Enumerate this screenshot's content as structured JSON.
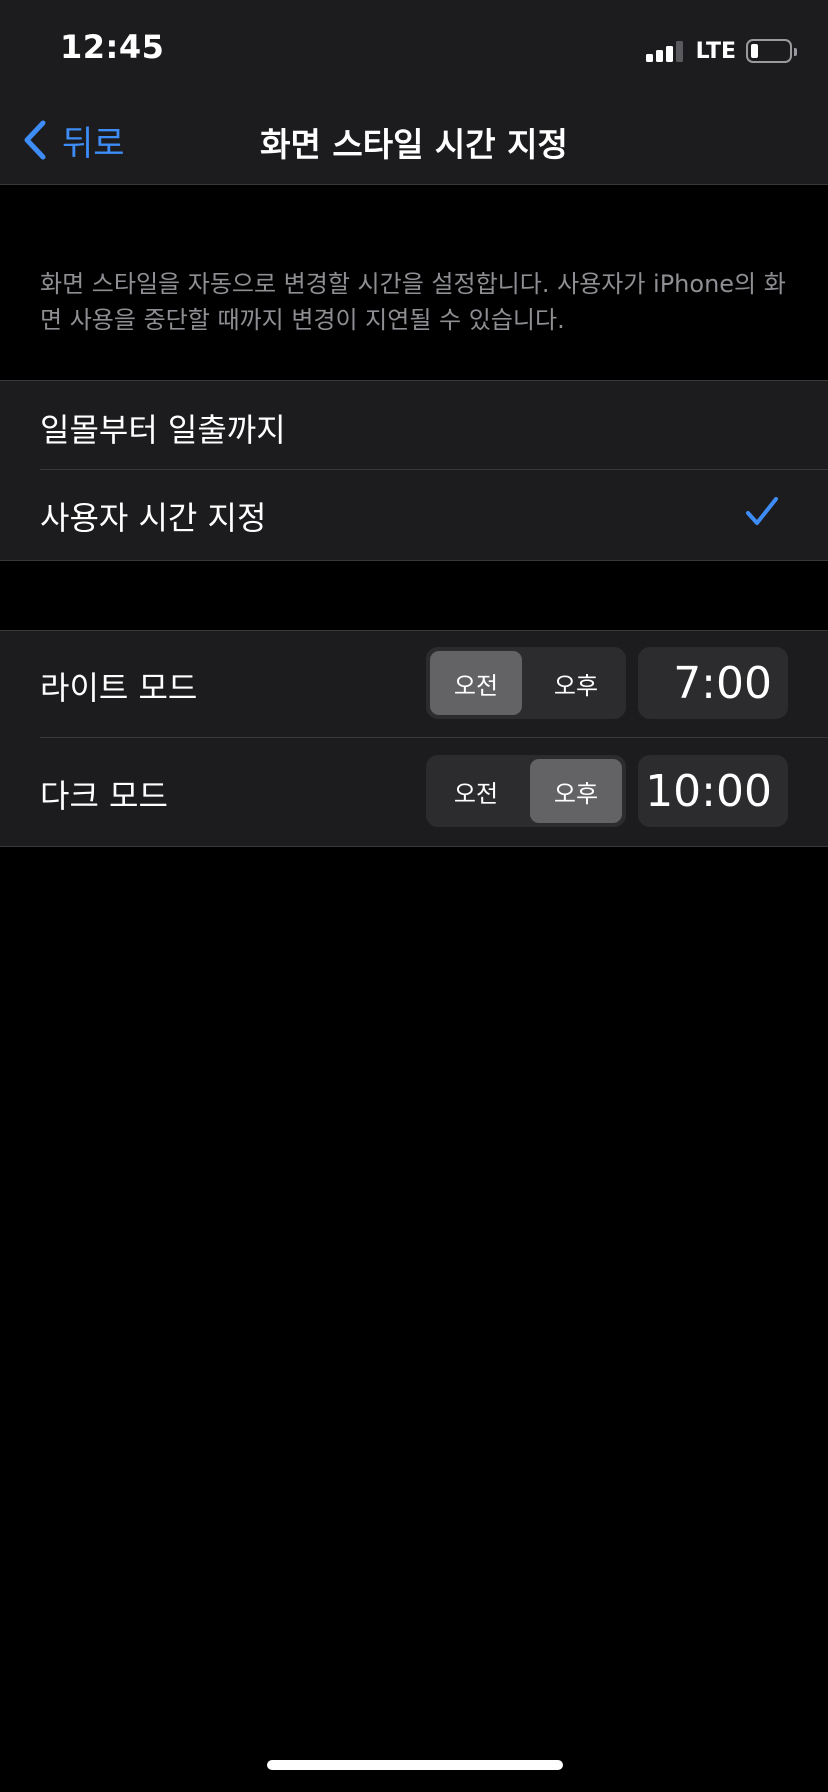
{
  "status_bar": {
    "time": "12:45",
    "network": "LTE",
    "battery_level": 0.2
  },
  "nav": {
    "back_label": "뒤로",
    "title": "화면 스타일 시간 지정"
  },
  "description": "화면 스타일을 자동으로 변경할 시간을 설정합니다. 사용자가 iPhone의 화면 사용을 중단할 때까지 변경이 지연될 수 있습니다.",
  "schedule_options": {
    "items": [
      {
        "label": "일몰부터 일출까지",
        "selected": false
      },
      {
        "label": "사용자 시간 지정",
        "selected": true
      }
    ]
  },
  "custom_schedule": {
    "rows": [
      {
        "label": "라이트 모드",
        "am_label": "오전",
        "pm_label": "오후",
        "selected_period": "am",
        "time": "7:00"
      },
      {
        "label": "다크 모드",
        "am_label": "오전",
        "pm_label": "오후",
        "selected_period": "pm",
        "time": "10:00"
      }
    ]
  },
  "colors": {
    "accent": "#3e8cf5",
    "background": "#000000",
    "cell_background": "#1c1c1e",
    "secondary_text": "#8e8e93",
    "segment_selected": "#636366"
  }
}
